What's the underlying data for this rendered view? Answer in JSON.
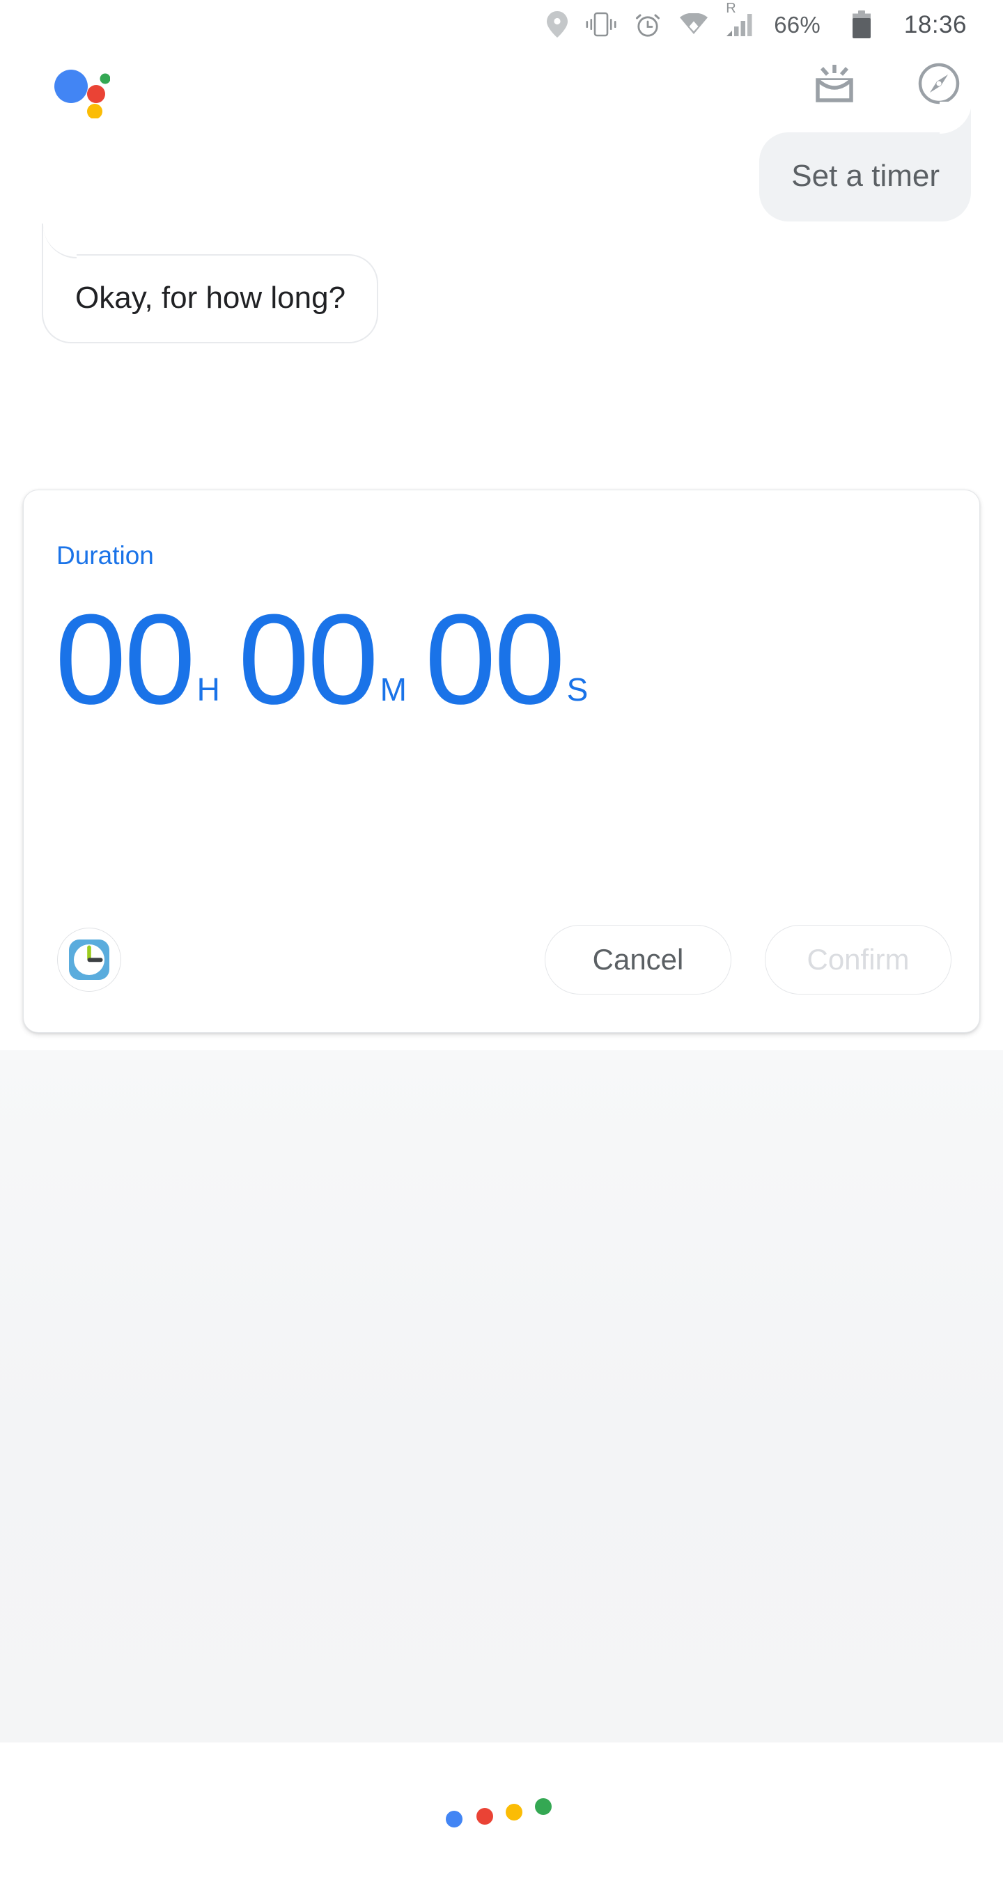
{
  "status_bar": {
    "icons": [
      "location-pin-icon",
      "vibrate-icon",
      "alarm-icon",
      "wifi-icon",
      "roaming-signal-icon"
    ],
    "roaming_label": "R",
    "battery_percent": "66%",
    "time": "18:36"
  },
  "header": {
    "logo": "google-assistant-logo",
    "snapshot_icon": "snapshot-inbox-icon",
    "explore_icon": "compass-explore-icon"
  },
  "conversation": {
    "user_message": "Set a timer",
    "assistant_message": "Okay, for how long?"
  },
  "timer_card": {
    "label": "Duration",
    "hours": "00",
    "hours_unit": "H",
    "minutes": "00",
    "minutes_unit": "M",
    "seconds": "00",
    "seconds_unit": "S",
    "app_icon": "clock-app-icon",
    "cancel_label": "Cancel",
    "confirm_label": "Confirm"
  },
  "footer": {
    "dots_indicator": "google-assistant-listening-dots"
  },
  "colors": {
    "accent_blue": "#1a73e8",
    "google_blue": "#4285f4",
    "google_red": "#ea4335",
    "google_yellow": "#fbbc05",
    "google_green": "#34a853",
    "user_bubble_bg": "#f0f2f4",
    "text_primary": "#202124",
    "text_secondary": "#5b6064",
    "disabled_text": "#dadce0"
  }
}
